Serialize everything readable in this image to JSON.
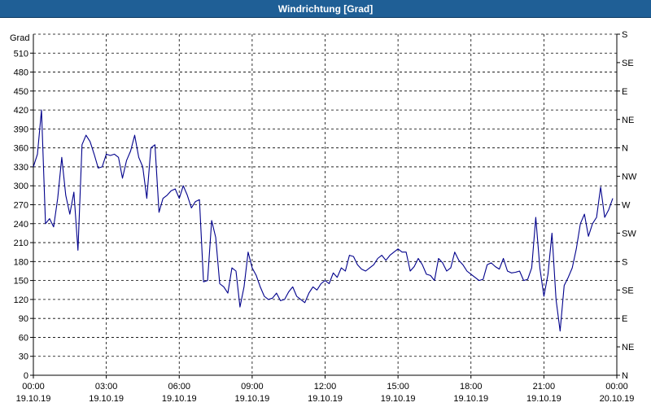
{
  "window": {
    "title": "Windrichtung [Grad]"
  },
  "chart_data": {
    "type": "line",
    "title": "Windrichtung [Grad]",
    "ylabel": "Grad",
    "ylim": [
      0,
      540
    ],
    "yticks": [
      0,
      30,
      60,
      90,
      120,
      150,
      180,
      210,
      240,
      270,
      300,
      330,
      360,
      390,
      420,
      450,
      480,
      510
    ],
    "right_axis_labels": [
      "N",
      "NE",
      "E",
      "SE",
      "S",
      "SW",
      "W",
      "NW",
      "N",
      "NE",
      "E",
      "SE",
      "S"
    ],
    "x_ticks": [
      {
        "time": "00:00",
        "date": "19.10.19"
      },
      {
        "time": "03:00",
        "date": "19.10.19"
      },
      {
        "time": "06:00",
        "date": "19.10.19"
      },
      {
        "time": "09:00",
        "date": "19.10.19"
      },
      {
        "time": "12:00",
        "date": "19.10.19"
      },
      {
        "time": "15:00",
        "date": "19.10.19"
      },
      {
        "time": "18:00",
        "date": "19.10.19"
      },
      {
        "time": "21:00",
        "date": "19.10.19"
      },
      {
        "time": "00:00",
        "date": "20.10.19"
      }
    ],
    "grid": true,
    "line_color": "#00008b",
    "series": [
      {
        "x": [
          "00:00",
          "00:10",
          "00:20",
          "00:30",
          "00:40",
          "00:50",
          "01:00",
          "01:10",
          "01:20",
          "01:30",
          "01:40",
          "01:50",
          "02:00",
          "02:10",
          "02:20",
          "02:30",
          "02:40",
          "02:50",
          "03:00",
          "03:10",
          "03:20",
          "03:30",
          "03:40",
          "03:50",
          "04:00",
          "04:10",
          "04:20",
          "04:30",
          "04:40",
          "04:50",
          "05:00",
          "05:10",
          "05:20",
          "05:30",
          "05:40",
          "05:50",
          "06:00",
          "06:10",
          "06:20",
          "06:30",
          "06:40",
          "06:50",
          "07:00",
          "07:10",
          "07:20",
          "07:30",
          "07:40",
          "07:50",
          "08:00",
          "08:10",
          "08:20",
          "08:30",
          "08:40",
          "08:50",
          "09:00",
          "09:10",
          "09:20",
          "09:30",
          "09:40",
          "09:50",
          "10:00",
          "10:10",
          "10:20",
          "10:30",
          "10:40",
          "10:50",
          "11:00",
          "11:10",
          "11:20",
          "11:30",
          "11:40",
          "11:50",
          "12:00",
          "12:10",
          "12:20",
          "12:30",
          "12:40",
          "12:50",
          "13:00",
          "13:10",
          "13:20",
          "13:30",
          "13:40",
          "13:50",
          "14:00",
          "14:10",
          "14:20",
          "14:30",
          "14:40",
          "14:50",
          "15:00",
          "15:10",
          "15:20",
          "15:30",
          "15:40",
          "15:50",
          "16:00",
          "16:10",
          "16:20",
          "16:30",
          "16:40",
          "16:50",
          "17:00",
          "17:10",
          "17:20",
          "17:30",
          "17:40",
          "17:50",
          "18:00",
          "18:10",
          "18:20",
          "18:30",
          "18:40",
          "18:50",
          "19:00",
          "19:10",
          "19:20",
          "19:30",
          "19:40",
          "19:50",
          "20:00",
          "20:10",
          "20:20",
          "20:30",
          "20:40",
          "20:50",
          "21:00",
          "21:10",
          "21:20",
          "21:30",
          "21:40",
          "21:50",
          "22:00",
          "22:10",
          "22:20",
          "22:30",
          "22:40",
          "22:50",
          "23:00",
          "23:10",
          "23:20",
          "23:30",
          "23:40",
          "23:50"
        ],
        "values": [
          330,
          350,
          420,
          240,
          248,
          235,
          280,
          345,
          285,
          255,
          290,
          198,
          365,
          380,
          370,
          350,
          328,
          330,
          350,
          348,
          350,
          345,
          312,
          340,
          355,
          380,
          345,
          330,
          280,
          360,
          365,
          258,
          280,
          285,
          292,
          295,
          280,
          300,
          285,
          265,
          275,
          278,
          148,
          150,
          245,
          218,
          145,
          140,
          130,
          170,
          165,
          108,
          140,
          195,
          170,
          158,
          140,
          125,
          120,
          122,
          130,
          118,
          120,
          132,
          140,
          125,
          120,
          115,
          130,
          140,
          135,
          145,
          150,
          145,
          162,
          155,
          170,
          165,
          190,
          188,
          175,
          168,
          165,
          170,
          175,
          185,
          190,
          182,
          190,
          195,
          200,
          195,
          195,
          165,
          172,
          185,
          175,
          160,
          158,
          150,
          185,
          178,
          165,
          170,
          195,
          182,
          175,
          165,
          160,
          155,
          150,
          152,
          175,
          178,
          172,
          168,
          185,
          165,
          162,
          163,
          165,
          150,
          152,
          170,
          250,
          170,
          125,
          160,
          225,
          120,
          70,
          142,
          155,
          170,
          200,
          240,
          255,
          220,
          240,
          250,
          298,
          250,
          262,
          280
        ]
      }
    ]
  }
}
